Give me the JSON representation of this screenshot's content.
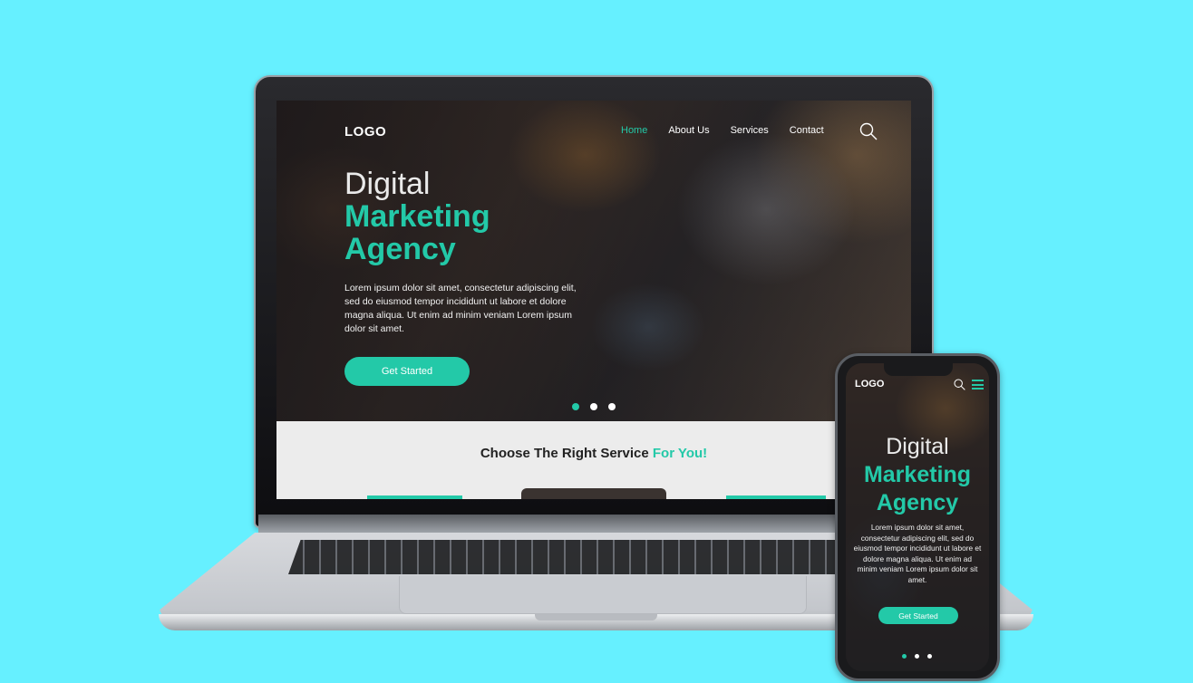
{
  "site": {
    "logo": "LOGO",
    "nav": [
      "Home",
      "About Us",
      "Services",
      "Contact"
    ],
    "active_nav": "Home",
    "hero": {
      "line1": "Digital",
      "line2": "Marketing",
      "line3": "Agency",
      "body": "Lorem ipsum dolor sit amet, consectetur adipiscing elit, sed do eiusmod tempor incididunt ut labore et dolore magna aliqua. Ut enim ad minim veniam Lorem ipsum dolor sit amet.",
      "cta_label": "Get Started",
      "slides": 3,
      "active_slide": 1
    },
    "services": {
      "title_prefix": "Choose The Right Service",
      "title_accent": "For You!"
    }
  },
  "mobile": {
    "logo": "LOGO",
    "hero": {
      "line1": "Digital",
      "line2": "Marketing",
      "line3": "Agency",
      "body": "Lorem ipsum dolor sit amet, consectetur adipiscing elit, sed do eiusmod tempor incididunt ut labore et dolore magna aliqua. Ut enim ad minim veniam Lorem ipsum dolor sit amet.",
      "cta_label": "Get Started"
    }
  },
  "colors": {
    "background": "#66f0ff",
    "accent": "#23c9a8"
  }
}
